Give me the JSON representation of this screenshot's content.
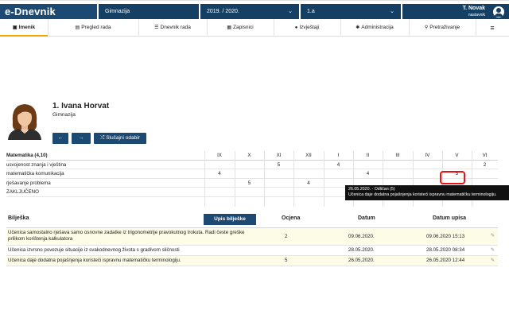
{
  "app": {
    "brand": "e-Dnevnik",
    "school": "Gimnazija",
    "year": "2019. / 2020.",
    "class": "1.a",
    "user_name": "T. Novak",
    "user_role": "nastavnik"
  },
  "tabs": [
    {
      "label": "Imenik",
      "icon": "book-icon"
    },
    {
      "label": "Pregled rada",
      "icon": "document-icon"
    },
    {
      "label": "Dnevnik rada",
      "icon": "list-icon"
    },
    {
      "label": "Zapisnici",
      "icon": "briefcase-icon"
    },
    {
      "label": "Izvještaji",
      "icon": "info-icon"
    },
    {
      "label": "Administracija",
      "icon": "gear-icon"
    },
    {
      "label": "Pretraživanje",
      "icon": "search-icon"
    }
  ],
  "student": {
    "name": "1. Ivana Horvat",
    "school": "Gimnazija",
    "prev_label": "←",
    "next_label": "→",
    "random_label": "Slučajni odabir"
  },
  "grades": {
    "subject": "Matematika (4,10)",
    "months": [
      "IX",
      "X",
      "XI",
      "XII",
      "I",
      "II",
      "III",
      "IV",
      "V",
      "VI"
    ],
    "rows": [
      {
        "label": "usvojenost znanja i vještina",
        "cells": [
          "",
          "",
          "5",
          "",
          "4",
          "",
          "",
          "",
          "",
          "2"
        ]
      },
      {
        "label": "matematička komunikacija",
        "cells": [
          "4",
          "",
          "",
          "",
          "",
          "4",
          "",
          "",
          "5",
          ""
        ]
      },
      {
        "label": "rješavanje problema",
        "cells": [
          "",
          "5",
          "",
          "4",
          "",
          "",
          "",
          "",
          "",
          ""
        ]
      },
      {
        "label": "ZAKLJUČENO",
        "cells": [
          "",
          "",
          "",
          "",
          "",
          "",
          "",
          "",
          "",
          ""
        ]
      }
    ],
    "tooltip_line1": "26.05.2020. - Odličan (5)",
    "tooltip_line2": "Učenica daje dodatna pojašnjenja koristeći ispravnu matematičku terminologiju."
  },
  "notes": {
    "title": "Bilješka",
    "add_button": "Upis bilješke",
    "col_grade": "Ocjena",
    "col_date": "Datum",
    "col_entry": "Datum upisa",
    "rows": [
      {
        "text": "Učenica samostalno rješava samo osnovne zadatke iz trigonometrije pravokutnog trokuta. Radi česte greške prilikom korištenja kalkulatora",
        "grade": "2",
        "date": "09.06.2020.",
        "entry": "09.06.2020 15:13"
      },
      {
        "text": "Učenica izvrsno povezuje situacije iz svakodnevnog života s gradivom sličnosti",
        "grade": "",
        "date": "28.05.2020.",
        "entry": "28.05.2020 08:34"
      },
      {
        "text": "Učenica daje dodatna pojašnjenja koristeći ispravnu matematičku terminologiju.",
        "grade": "5",
        "date": "26.05.2020.",
        "entry": "26.05.2020 12:44"
      }
    ]
  }
}
